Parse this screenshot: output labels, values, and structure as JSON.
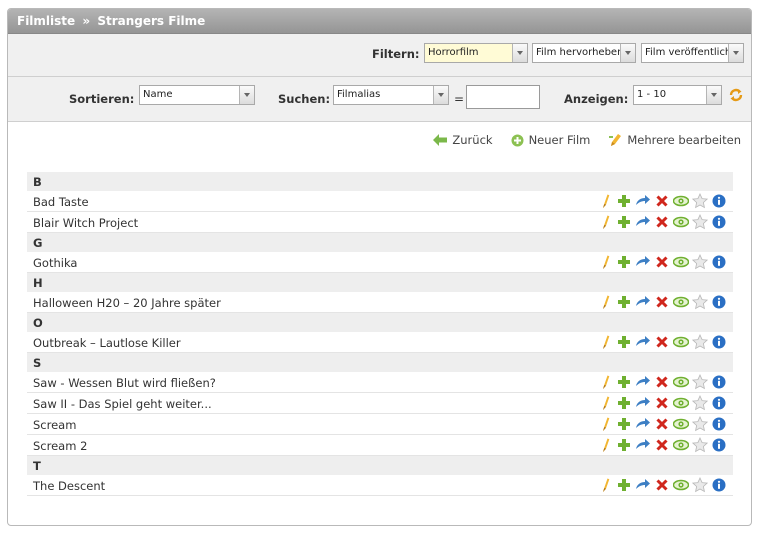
{
  "header": {
    "crumb_1": "Filmliste",
    "separator": "»",
    "crumb_2": "Strangers Filme"
  },
  "filter": {
    "label": "Filtern:",
    "genre": "Horrorfilm",
    "highlight": "Film hervorheben",
    "published": "Film veröffentlicht"
  },
  "sort": {
    "label": "Sortieren:",
    "value": "Name"
  },
  "search": {
    "label": "Suchen:",
    "field": "Filmalias",
    "equals": "=",
    "value": ""
  },
  "display": {
    "label": "Anzeigen:",
    "value": "1 - 10"
  },
  "actions": {
    "back": "Zurück",
    "new_film": "Neuer Film",
    "edit_multiple": "Mehrere bearbeiten"
  },
  "groups": [
    {
      "letter": "B",
      "films": [
        "Bad Taste",
        "Blair Witch Project"
      ]
    },
    {
      "letter": "G",
      "films": [
        "Gothika"
      ]
    },
    {
      "letter": "H",
      "films": [
        "Halloween H20 – 20 Jahre später"
      ]
    },
    {
      "letter": "O",
      "films": [
        "Outbreak – Lautlose Killer"
      ]
    },
    {
      "letter": "S",
      "films": [
        "Saw - Wessen Blut wird fließen?",
        "Saw II - Das Spiel geht weiter...",
        "Scream",
        "Scream 2"
      ]
    },
    {
      "letter": "T",
      "films": [
        "The Descent"
      ]
    }
  ],
  "row_icons": [
    "pencil-icon",
    "plus-icon",
    "move-arrow-icon",
    "delete-x-icon",
    "eye-icon",
    "star-icon",
    "info-icon"
  ],
  "colors": {
    "title_bar": "#a5a5a5",
    "highlight_field": "#fffbd6",
    "plus_green": "#6fb030",
    "delete_red": "#d0271d",
    "info_blue": "#2a6fc4"
  }
}
